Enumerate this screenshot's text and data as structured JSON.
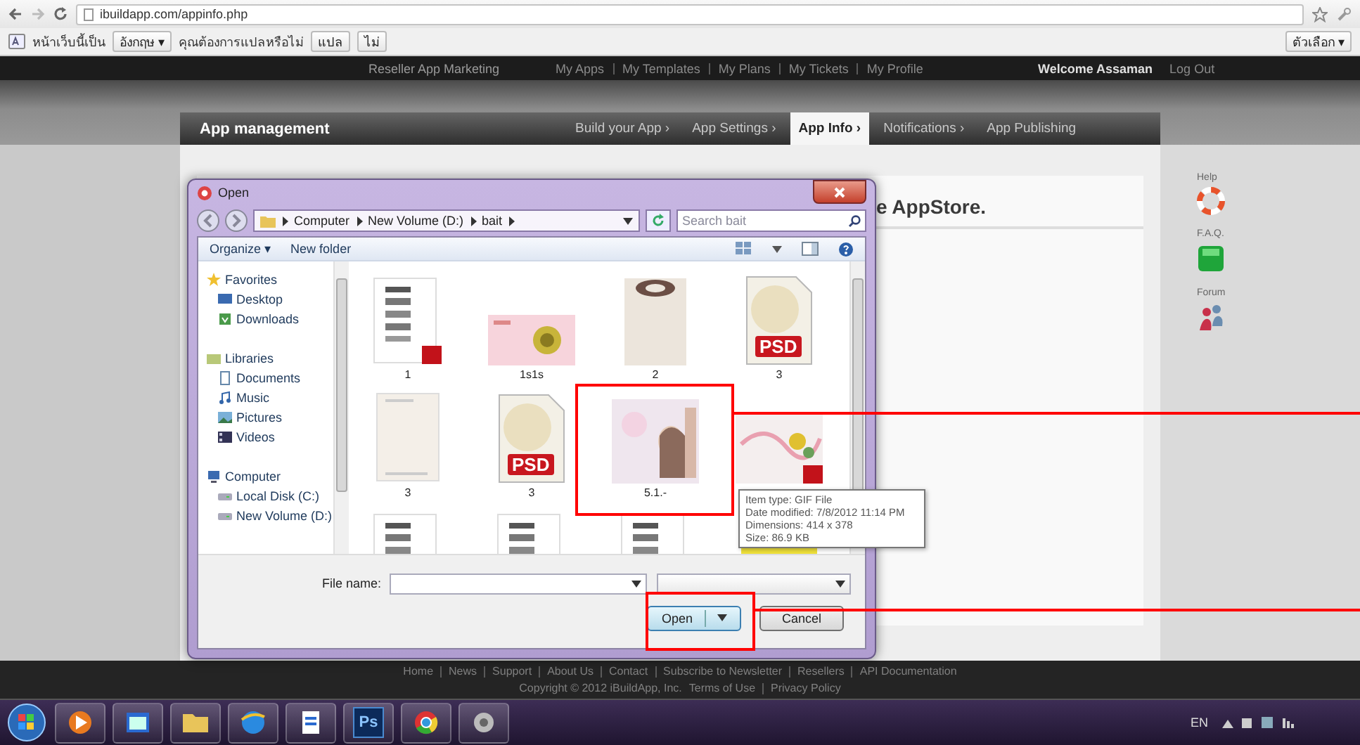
{
  "browser": {
    "url": "ibuildapp.com/appinfo.php"
  },
  "translate_bar": {
    "message": "หน้าเว็บนี้เป็น",
    "language": "อังกฤษ ▾",
    "question": "คุณต้องการแปลหรือไม่",
    "translate_button": "แปล",
    "dismiss_button": "ไม่",
    "options_button": "ตัวเลือก ▾"
  },
  "site": {
    "tagline": "Reseller App Marketing",
    "top_links": [
      "My Apps",
      "My Templates",
      "My Plans",
      "My Tickets",
      "My Profile"
    ],
    "welcome": "Welcome Assaman",
    "logout": "Log Out",
    "section_title": "App management",
    "steps": [
      {
        "label": "Build your App ›",
        "selected": false
      },
      {
        "label": "App Settings ›",
        "selected": false
      },
      {
        "label": "App Info ›",
        "selected": true
      },
      {
        "label": "Notifications ›",
        "selected": false
      },
      {
        "label": "App Publishing",
        "selected": false
      }
    ],
    "heading": "e AppStore.",
    "help": [
      {
        "label": "Help",
        "kind": "lifebuoy"
      },
      {
        "label": "F.A.Q.",
        "kind": "faq"
      },
      {
        "label": "Forum",
        "kind": "forum"
      }
    ],
    "footer_links": [
      "Home",
      "News",
      "Support",
      "About Us",
      "Contact",
      "Subscribe to Newsletter",
      "Resellers",
      "API Documentation"
    ],
    "copyright": "Copyright © 2012 iBuildApp, Inc.",
    "footer_legal": [
      "Terms of Use",
      "Privacy Policy"
    ]
  },
  "dialog": {
    "title": "Open",
    "breadcrumb": [
      "Computer",
      "New Volume (D:)",
      "bait"
    ],
    "search_placeholder": "Search bait",
    "toolbar": [
      "Organize ▾",
      "New folder"
    ],
    "nav": [
      {
        "label": "Favorites",
        "kind": "star",
        "children": [
          {
            "label": "Desktop",
            "kind": "desktop"
          },
          {
            "label": "Downloads",
            "kind": "downloads"
          }
        ]
      },
      {
        "label": "Libraries",
        "kind": "library",
        "children": [
          {
            "label": "Documents",
            "kind": "documents"
          },
          {
            "label": "Music",
            "kind": "music"
          },
          {
            "label": "Pictures",
            "kind": "pictures"
          },
          {
            "label": "Videos",
            "kind": "videos"
          }
        ]
      },
      {
        "label": "Computer",
        "kind": "computer",
        "children": [
          {
            "label": "Local Disk (C:)",
            "kind": "disk"
          },
          {
            "label": "New Volume (D:)",
            "kind": "disk"
          }
        ]
      }
    ],
    "files": [
      {
        "name": "1",
        "kind": "list"
      },
      {
        "name": "1s1s",
        "kind": "card"
      },
      {
        "name": "2",
        "kind": "frame"
      },
      {
        "name": "3",
        "kind": "psd",
        "badge": "PSD"
      },
      {
        "name": "3",
        "kind": "blank"
      },
      {
        "name": "3",
        "kind": "psd",
        "badge": "PSD"
      },
      {
        "name": "5.1.-"
      },
      {
        "kind": "collage"
      },
      {
        "kind": "list"
      },
      {
        "kind": "list"
      },
      {
        "kind": "list"
      },
      {
        "kind": "yellow"
      }
    ],
    "tooltip": [
      "Item type: GIF File",
      "Date modified: 7/8/2012 11:14 PM",
      "Dimensions: 414 x 378",
      "Size: 86.9 KB"
    ],
    "file_name_label": "File name:",
    "buttons": [
      {
        "label": "Open",
        "kind": "split"
      },
      {
        "label": "Cancel",
        "kind": "plain"
      }
    ]
  },
  "annotations": [
    {
      "kind": "callout"
    },
    {
      "kind": "callout"
    }
  ],
  "taskbar": {
    "apps": [
      {
        "kind": "start"
      },
      {
        "kind": "media"
      },
      {
        "kind": "window"
      },
      {
        "kind": "folder"
      },
      {
        "kind": "browser"
      },
      {
        "kind": "doc"
      },
      {
        "kind": "ps",
        "label": "Ps"
      },
      {
        "kind": "chrome"
      },
      {
        "kind": "app"
      }
    ],
    "language": "EN"
  }
}
